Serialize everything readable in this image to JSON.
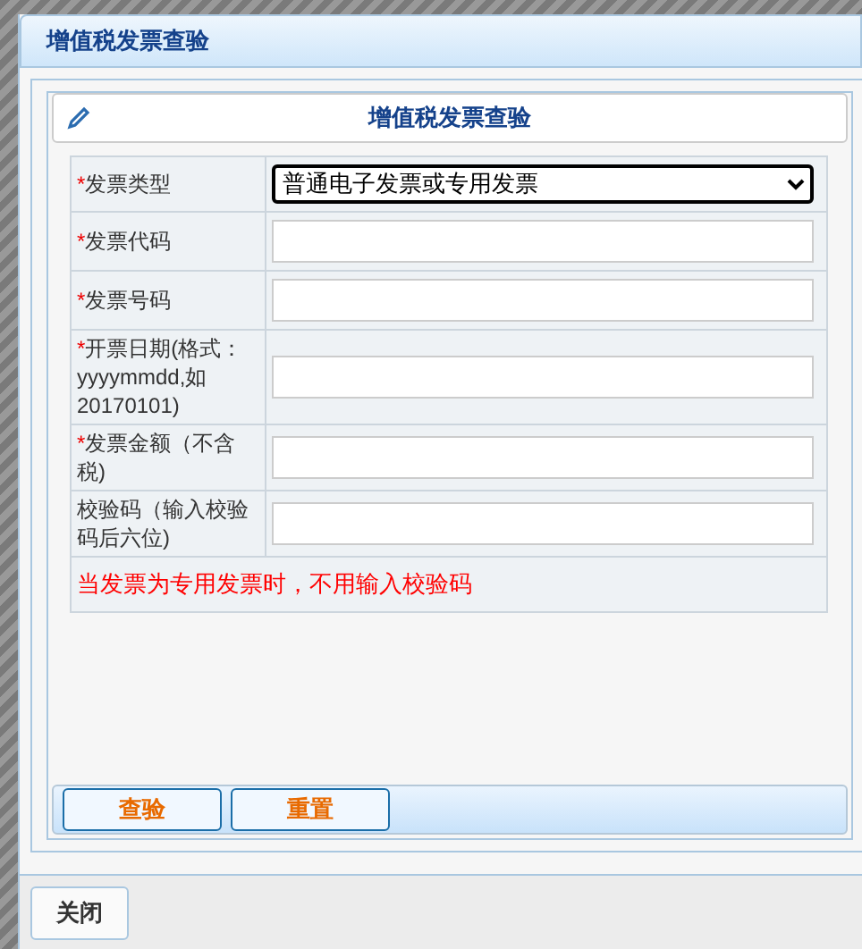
{
  "window": {
    "title": "增值税发票查验"
  },
  "panel": {
    "title": "增值税发票查验"
  },
  "fields": [
    {
      "kind": "select",
      "mark": "*",
      "label": "发票类型",
      "value": "普通电子发票或专用发票"
    },
    {
      "kind": "text",
      "mark": "*",
      "label": "发票代码"
    },
    {
      "kind": "text",
      "mark": "*",
      "label": "发票号码"
    },
    {
      "kind": "text",
      "mark": "*",
      "label": "开票日期(格式：yyyymmdd,如20170101)"
    },
    {
      "kind": "text",
      "mark": "*",
      "label": "发票金额（不含税)"
    },
    {
      "kind": "text",
      "label": "校验码（输入校验码后六位)"
    }
  ],
  "hint": "当发票为专用发票时，不用输入校验码",
  "buttons": [
    "查验",
    "重置"
  ],
  "footer_button": "关闭"
}
